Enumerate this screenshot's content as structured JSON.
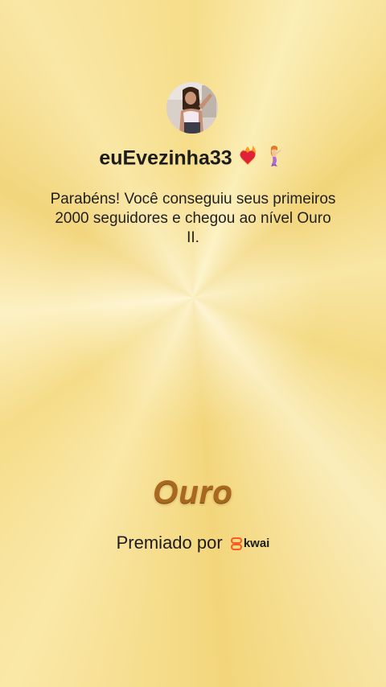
{
  "profile": {
    "username": "euEvezinha33",
    "emojis": [
      "heart-on-fire-icon",
      "mermaid-icon"
    ]
  },
  "message": "Parabéns! Você conseguiu seus primeiros 2000 seguidores e chegou ao nível Ouro II.",
  "tier": "Ouro",
  "awarded": {
    "label": "Premiado por",
    "brand": "kwai"
  },
  "colors": {
    "tier_text": "#a8681f",
    "brand_accent": "#ff5a1f"
  }
}
